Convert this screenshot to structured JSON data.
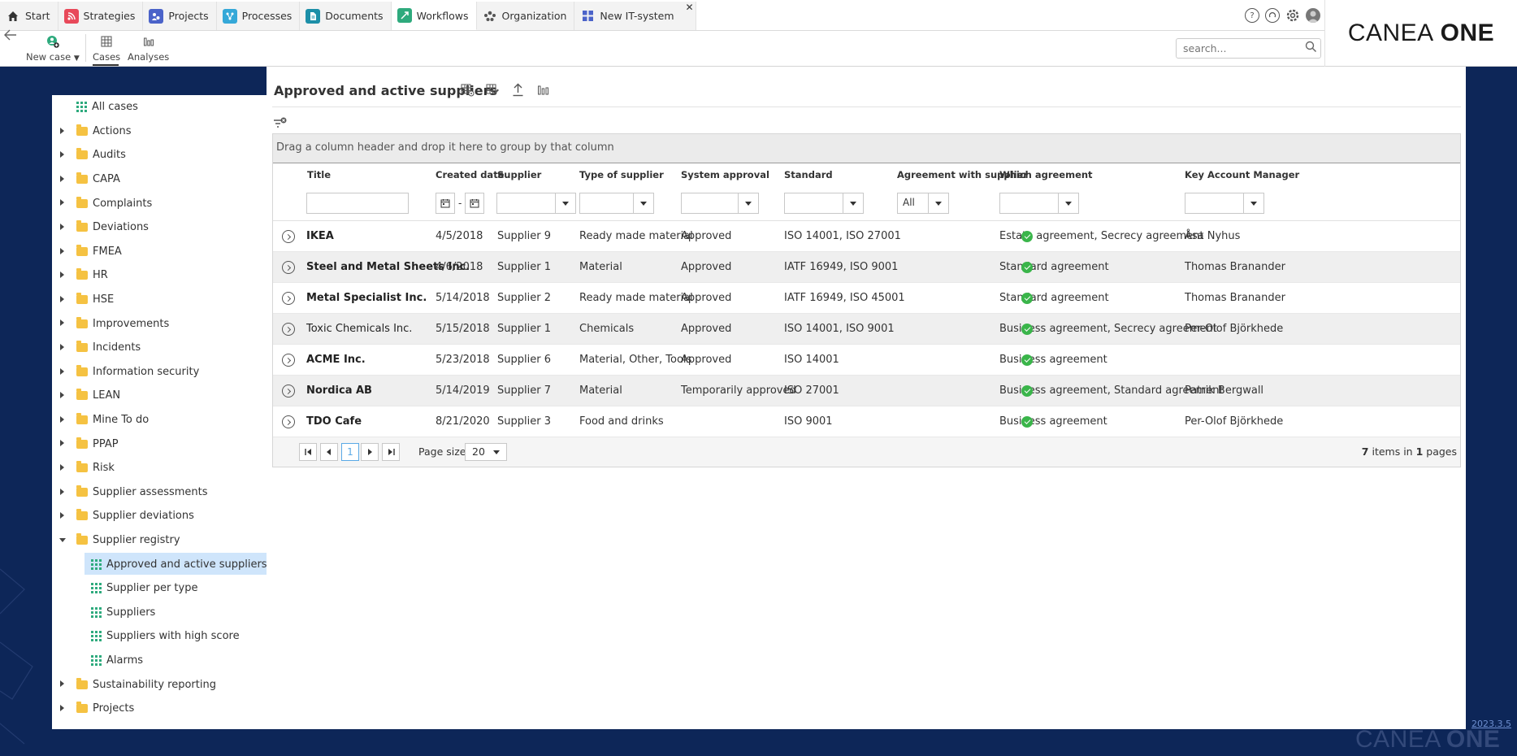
{
  "tabs": [
    {
      "label": "Start",
      "icon": "home-icon",
      "color": "#333333"
    },
    {
      "label": "Strategies",
      "icon": "strategies-icon",
      "color": "#e8495a"
    },
    {
      "label": "Projects",
      "icon": "projects-icon",
      "color": "#4b63c9"
    },
    {
      "label": "Processes",
      "icon": "processes-icon",
      "color": "#35a8d8"
    },
    {
      "label": "Documents",
      "icon": "documents-icon",
      "color": "#1c8fa8"
    },
    {
      "label": "Workflows",
      "icon": "workflows-icon",
      "color": "#2eaa7d"
    },
    {
      "label": "Organization",
      "icon": "organization-icon",
      "color": "#555555"
    },
    {
      "label": "New IT-system",
      "icon": "it-system-icon",
      "color": "#4b63c9"
    }
  ],
  "logo": {
    "light": "CANEA",
    "bold": "ONE"
  },
  "toolbar": {
    "new_case": "New case",
    "cases": "Cases",
    "analyses": "Analyses"
  },
  "search": {
    "placeholder": "search..."
  },
  "tree": {
    "all_cases": "All cases",
    "folders": [
      "Actions",
      "Audits",
      "CAPA",
      "Complaints",
      "Deviations",
      "FMEA",
      "HR",
      "HSE",
      "Improvements",
      "Incidents",
      "Information security",
      "LEAN",
      "Mine To do",
      "PPAP",
      "Risk",
      "Supplier assessments",
      "Supplier deviations",
      "Supplier registry"
    ],
    "children": [
      "Approved and active suppliers",
      "Supplier per type",
      "Suppliers",
      "Suppliers with high score",
      "Alarms"
    ],
    "tail_folders": [
      "Sustainability reporting",
      "Projects"
    ]
  },
  "page": {
    "title": "Approved and active suppliers"
  },
  "grid": {
    "group_hint": "Drag a column header and drop it here to group by that column",
    "columns": {
      "title": "Title",
      "created": "Created date",
      "supplier": "Supplier",
      "type": "Type of supplier",
      "approval": "System approval",
      "standard": "Standard",
      "agreement_with": "Agreement with supplier",
      "which_agreement": "Which agreement",
      "kam": "Key Account Manager"
    },
    "agreement_filter": "All",
    "rows": [
      {
        "title": "IKEA",
        "bold": true,
        "created": "4/5/2018",
        "supplier": "Supplier 9",
        "type": "Ready made material",
        "approval": "Approved",
        "standard": "ISO 14001, ISO 27001",
        "agreement": "Estate agreement, Secrecy agreement",
        "kam": "Åsa Nyhus"
      },
      {
        "title": "Steel and Metal Sheets Inc.",
        "bold": true,
        "created": "4/6/2018",
        "supplier": "Supplier 1",
        "type": "Material",
        "approval": "Approved",
        "standard": "IATF 16949, ISO 9001",
        "agreement": "Standard agreement",
        "kam": "Thomas Branander"
      },
      {
        "title": "Metal Specialist Inc.",
        "bold": true,
        "created": "5/14/2018",
        "supplier": "Supplier 2",
        "type": "Ready made material",
        "approval": "Approved",
        "standard": "IATF 16949, ISO 45001",
        "agreement": "Standard agreement",
        "kam": "Thomas Branander"
      },
      {
        "title": "Toxic Chemicals Inc.",
        "bold": false,
        "created": "5/15/2018",
        "supplier": "Supplier 1",
        "type": "Chemicals",
        "approval": "Approved",
        "standard": "ISO 14001, ISO 9001",
        "agreement": "Business agreement, Secrecy agreement",
        "kam": "Per-Olof Björkhede"
      },
      {
        "title": "ACME Inc.",
        "bold": true,
        "created": "5/23/2018",
        "supplier": "Supplier 6",
        "type": "Material, Other, Tools",
        "approval": "Approved",
        "standard": "ISO 14001",
        "agreement": "Business agreement",
        "kam": ""
      },
      {
        "title": "Nordica AB",
        "bold": true,
        "created": "5/14/2019",
        "supplier": "Supplier 7",
        "type": "Material",
        "approval": "Temporarily approved",
        "standard": "ISO 27001",
        "agreement": "Business agreement, Standard agreement",
        "kam": "Patrik Bergwall"
      },
      {
        "title": "TDO Cafe",
        "bold": true,
        "created": "8/21/2020",
        "supplier": "Supplier 3",
        "type": "Food and drinks",
        "approval": "",
        "standard": "ISO 9001",
        "agreement": "Business agreement",
        "kam": "Per-Olof Björkhede"
      }
    ]
  },
  "pager": {
    "current": "1",
    "size_label": "Page size:",
    "size": "20",
    "items": "7",
    "items_in": "items in",
    "pages": "1",
    "pages_label": "pages"
  },
  "footer": {
    "version": "2023.3.5"
  }
}
